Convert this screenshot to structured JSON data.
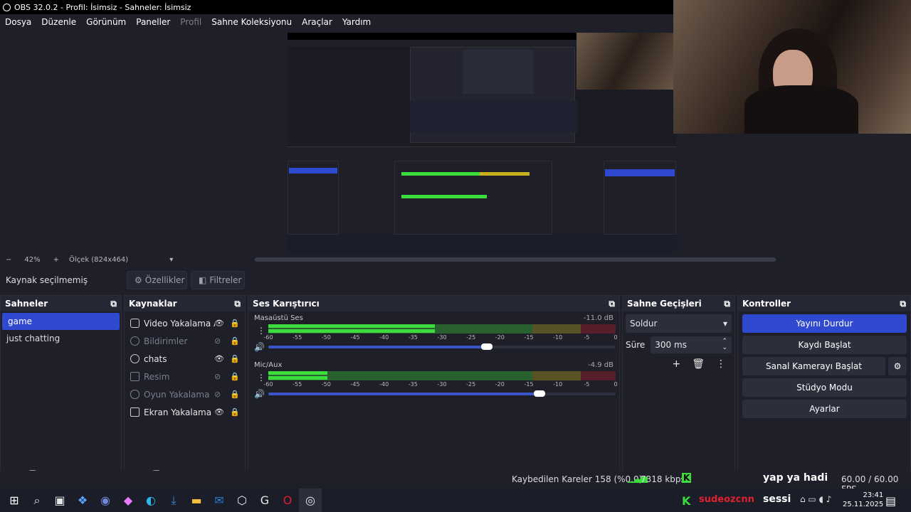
{
  "window": {
    "title": "OBS 32.0.2 - Profil: İsimsiz - Sahneler: İsimsiz"
  },
  "menu": [
    "Dosya",
    "Düzenle",
    "Görünüm",
    "Paneller",
    "Profil",
    "Sahne Koleksiyonu",
    "Araçlar",
    "Yardım"
  ],
  "zoom": {
    "minus": "−",
    "value": "42%",
    "plus": "+",
    "scale_label": "Ölçek (824x464)"
  },
  "toolbar": {
    "no_source": "Kaynak seçilmemiş",
    "properties": "Özellikler",
    "filters": "Filtreler"
  },
  "scenes": {
    "title": "Sahneler",
    "items": [
      "game",
      "just chatting"
    ],
    "selected": 0
  },
  "sources": {
    "title": "Kaynaklar",
    "items": [
      {
        "name": "Video Yakalama Ay",
        "icon": "camera-icon",
        "visible": true,
        "locked": true
      },
      {
        "name": "Bildirimler",
        "icon": "globe-icon",
        "visible": false,
        "locked": true
      },
      {
        "name": "chats",
        "icon": "globe-icon",
        "visible": true,
        "locked": true
      },
      {
        "name": "Resim",
        "icon": "image-icon",
        "visible": false,
        "locked": true
      },
      {
        "name": "Oyun Yakalama",
        "icon": "gamepad-icon",
        "visible": false,
        "locked": true
      },
      {
        "name": "Ekran Yakalama",
        "icon": "monitor-icon",
        "visible": true,
        "locked": true
      }
    ]
  },
  "mixer": {
    "title": "Ses Karıştırıcı",
    "ticks": [
      "-60",
      "-55",
      "-50",
      "-45",
      "-40",
      "-35",
      "-30",
      "-25",
      "-20",
      "-15",
      "-10",
      "-5",
      "0"
    ],
    "tracks": [
      {
        "name": "Masaüstü Ses",
        "db": "-11.0 dB",
        "volume": 0.63,
        "level": 0.48
      },
      {
        "name": "Mic/Aux",
        "db": "-4.9 dB",
        "volume": 0.78,
        "level": 0.17
      }
    ]
  },
  "transitions": {
    "title": "Sahne Geçişleri",
    "type": "Soldur",
    "duration_label": "Süre",
    "duration": "300 ms"
  },
  "controls": {
    "title": "Kontroller",
    "buttons": [
      "Yayını Durdur",
      "Kaydı Başlat",
      "Sanal Kamerayı Başlat",
      "Stüdyo Modu",
      "Ayarlar"
    ]
  },
  "status": {
    "dropped": "Kaybedilen Kareler 158 (%0.0)",
    "bitrate": "7318 kbps",
    "fps": "60.00 / 60.00 FPS"
  },
  "overlay": {
    "user": "sudeozcnn",
    "text": "sessi",
    "chat": "yap ya hadi"
  },
  "clock": {
    "time": "23:41",
    "date": "25.11.2025"
  },
  "colors": {
    "accent": "#2f4ad0",
    "meter_green": "#3ddc3d",
    "meter_yellow": "#c9b11c",
    "meter_red": "#c21f2f",
    "bg": "#1e1f29"
  }
}
